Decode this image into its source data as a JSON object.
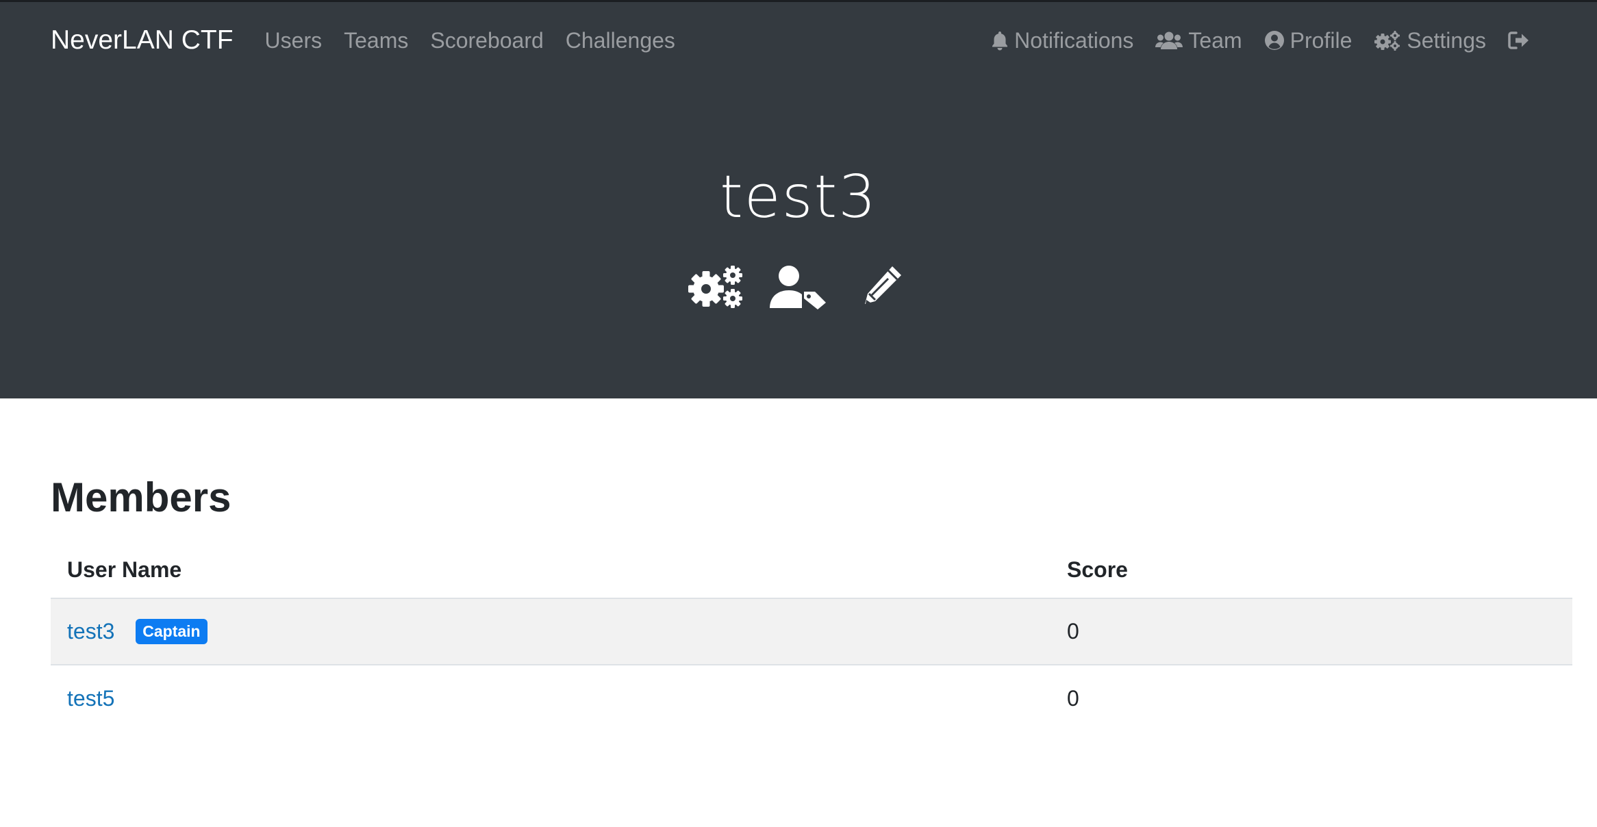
{
  "navbar": {
    "brand": "NeverLAN CTF",
    "left_links": [
      {
        "label": "Users"
      },
      {
        "label": "Teams"
      },
      {
        "label": "Scoreboard"
      },
      {
        "label": "Challenges"
      }
    ],
    "right_links": [
      {
        "label": "Notifications",
        "icon": "bell-icon"
      },
      {
        "label": "Team",
        "icon": "users-icon"
      },
      {
        "label": "Profile",
        "icon": "user-circle-icon"
      },
      {
        "label": "Settings",
        "icon": "cogs-icon"
      },
      {
        "label": "",
        "icon": "sign-out-icon"
      }
    ]
  },
  "team": {
    "name": "test3",
    "actions": [
      {
        "icon": "cogs-icon"
      },
      {
        "icon": "user-tag-icon"
      },
      {
        "icon": "pencil-icon"
      }
    ]
  },
  "members": {
    "heading": "Members",
    "columns": [
      "User Name",
      "Score"
    ],
    "rows": [
      {
        "name": "test3",
        "badge": "Captain",
        "score": "0"
      },
      {
        "name": "test5",
        "badge": "",
        "score": "0"
      }
    ]
  },
  "colors": {
    "hero_bg": "#343a40",
    "link": "#1473b8",
    "badge": "#0d7cf2",
    "nav_text": "#9a9da1"
  }
}
